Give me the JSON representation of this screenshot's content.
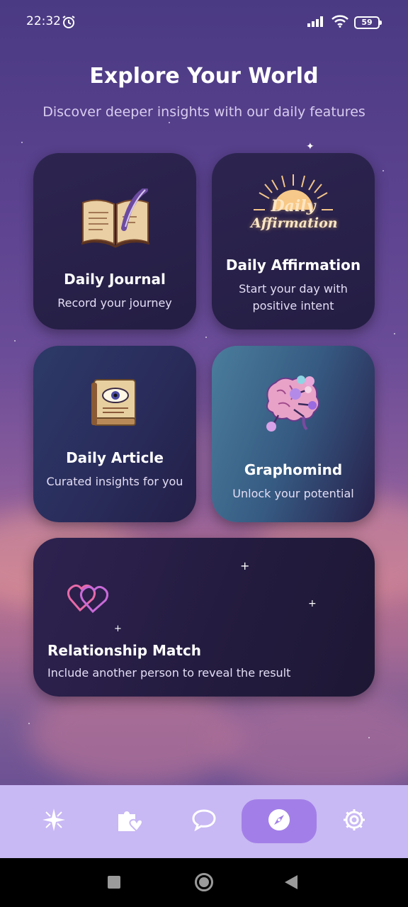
{
  "status_bar": {
    "time": "22:32",
    "battery": "59",
    "icons": [
      "alarm-icon",
      "signal-icon",
      "wifi-icon",
      "battery-icon"
    ]
  },
  "header": {
    "title": "Explore Your World",
    "subtitle": "Discover deeper insights with our daily features"
  },
  "cards": {
    "journal": {
      "title": "Daily Journal",
      "description": "Record your journey",
      "icon": "open-book-quill-icon"
    },
    "affirmation": {
      "title": "Daily Affirmation",
      "description": "Start your day with positive intent",
      "icon": "daily-affirmation-logo",
      "logo_text_1": "Daily",
      "logo_text_2": "Affirmation"
    },
    "article": {
      "title": "Daily Article",
      "description": "Curated insights for you",
      "icon": "eye-book-icon"
    },
    "graphomind": {
      "title": "Graphomind",
      "description": "Unlock your potential",
      "icon": "brain-network-icon"
    },
    "relationship": {
      "title": "Relationship Match",
      "description": "Include another person to reveal the result",
      "icon": "double-heart-icon"
    }
  },
  "bottom_nav": {
    "items": [
      {
        "name": "sparkle-icon",
        "active": false
      },
      {
        "name": "puzzle-heart-icon",
        "active": false
      },
      {
        "name": "chat-bubble-icon",
        "active": false
      },
      {
        "name": "compass-icon",
        "active": true
      },
      {
        "name": "gear-icon",
        "active": false
      }
    ],
    "background": "#c8b8f4",
    "active_color": "#a27fe8"
  },
  "android_nav": [
    "recents-button",
    "home-button",
    "back-button"
  ]
}
